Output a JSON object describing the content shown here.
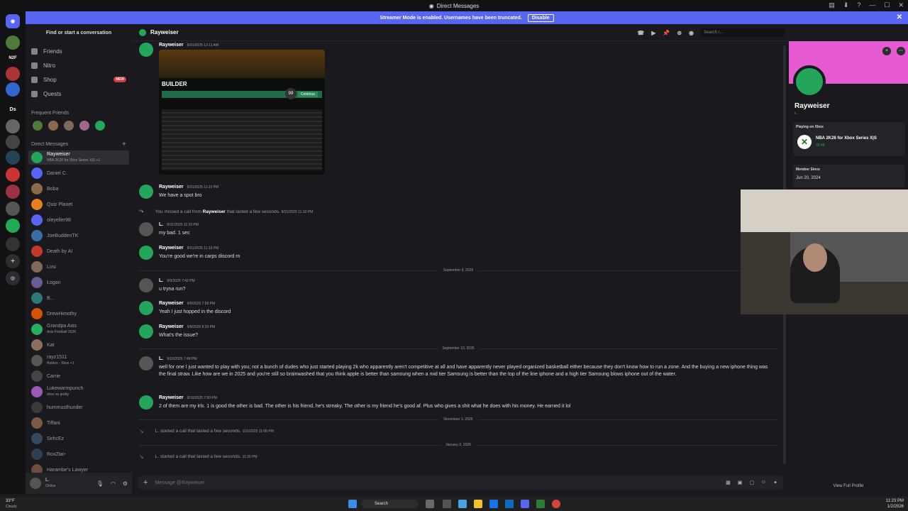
{
  "window": {
    "title": "Direct Messages"
  },
  "banner": {
    "text": "Streamer Mode is enabled. Usernames have been truncated.",
    "button": "Disable"
  },
  "servers": [
    "N2F",
    "Ds"
  ],
  "sidebar": {
    "find": "Find or start a conversation",
    "nav": [
      {
        "label": "Friends"
      },
      {
        "label": "Nitro"
      },
      {
        "label": "Shop",
        "badge": "NEW"
      },
      {
        "label": "Quests"
      }
    ],
    "frequent_label": "Frequent Friends",
    "dm_label": "Direct Messages",
    "dms": [
      {
        "name": "Rayweiser",
        "sub": "NBA 2K26 for Xbox Series X|S +1",
        "color": "#23a55a"
      },
      {
        "name": "Daniel C.",
        "sub": "",
        "color": "#5865f2"
      },
      {
        "name": "Boba",
        "sub": "",
        "color": "#8a6a4a"
      },
      {
        "name": "Quiz Planet",
        "sub": "",
        "color": "#e67e22"
      },
      {
        "name": "oleyeller98",
        "sub": "",
        "color": "#5865f2"
      },
      {
        "name": "JoeBuddenTK",
        "sub": "",
        "color": "#3a6ea5"
      },
      {
        "name": "Death by AI",
        "sub": "",
        "color": "#c0392b"
      },
      {
        "name": "Losi",
        "sub": "",
        "color": "#7f6a5a"
      },
      {
        "name": "Łogan",
        "sub": "",
        "color": "#6b5b95"
      },
      {
        "name": "B...",
        "sub": "",
        "color": "#2c7a7b"
      },
      {
        "name": "DrewHimothy",
        "sub": "",
        "color": "#d35400"
      },
      {
        "name": "Grandpa Axis",
        "sub": "Axis Football 2026",
        "color": "#27ae60"
      },
      {
        "name": "Kat",
        "sub": "",
        "color": "#8e6f5e"
      },
      {
        "name": "rayz1511",
        "sub": "Roblox - Xbox +1",
        "color": "#555"
      },
      {
        "name": "Carrie",
        "sub": "",
        "color": "#444"
      },
      {
        "name": "Lukewarmpunch",
        "sub": "shes so pretty",
        "color": "#9b59b6"
      },
      {
        "name": "hummusthunder",
        "sub": "",
        "color": "#3a3a3a"
      },
      {
        "name": "Tiffani",
        "sub": "",
        "color": "#7a5c4a"
      },
      {
        "name": "SirhcEz",
        "sub": "",
        "color": "#34495e"
      },
      {
        "name": "RoxZtar-",
        "sub": "",
        "color": "#2c3e50"
      },
      {
        "name": "Harambe's Lawyer",
        "sub": "",
        "color": "#6d4c41"
      }
    ],
    "user": {
      "name": "L.",
      "status": "Online"
    }
  },
  "header": {
    "name": "Rayweiser",
    "search": "Search r..."
  },
  "messages": [
    {
      "author": "Rayweiser",
      "time": "8/31/2025 12:11 AM",
      "text": "",
      "color": "#23a55a"
    },
    {
      "author": "Rayweiser",
      "time": "8/31/2025 11:10 PM",
      "text": "We have a spot bro",
      "color": "#23a55a"
    },
    {
      "author": "L.",
      "time": "8/31/2025 11:19 PM",
      "text": "my bad. 1 sec",
      "color": "#555"
    },
    {
      "author": "Rayweiser",
      "time": "8/31/2025 11:19 PM",
      "text": "You're good we're in carps discord rn",
      "color": "#23a55a"
    },
    {
      "author": "L.",
      "time": "9/9/2025 7:43 PM",
      "text": "u tryna run?",
      "color": "#555"
    },
    {
      "author": "Rayweiser",
      "time": "9/9/2025 7:58 PM",
      "text": "Yeah I just hopped in the discord",
      "color": "#23a55a"
    },
    {
      "author": "Rayweiser",
      "time": "9/9/2025 8:39 PM",
      "text": "What's the issue?",
      "color": "#23a55a"
    },
    {
      "author": "L.",
      "time": "9/10/2025 7:48 PM",
      "text": "well for one I just wanted to play with you; not a bunch of dudes who just started playing 2k who apparently aren't competitive at all and have apparently never played organized basketball either because they don't know how to run a zone. And the buying a new iphone thing was the final straw.  Like how are we in 2025 and you're still so brainwashed that you think apple is better than samsung when a mid tier Samsung is better than the top of the line iphone and a high tier Samsung blows iphone out of the water.",
      "color": "#555"
    },
    {
      "author": "Rayweiser",
      "time": "9/10/2025 7:50 PM",
      "text": "2 of them are my irls. 1 is good the other is bad. The other is his friend, he's streaky. The other is my friend he's good af. Plus who gives a shit what he does with his money. He earned it lol",
      "color": "#23a55a"
    }
  ],
  "system": {
    "missed": "You missed a call from",
    "missed_who": "Rayweiser",
    "missed_tail": "that lasted a few seconds.",
    "missed_time": "8/31/2025 11:10 PM",
    "call1": "L. started a call that lasted a few seconds.",
    "call1_time": "11/1/2025 11:08 PM",
    "call2": "L. started a call that lasted a few seconds.",
    "call2_time": "11:20 PM"
  },
  "dividers": [
    "September 9, 2025",
    "September 10, 2025",
    "November 1, 2025",
    "January 2, 2026"
  ],
  "attachment": {
    "title": "BUILDER",
    "rating": "99",
    "button": "Continue"
  },
  "composer": {
    "placeholder": "Message @Rayweiser"
  },
  "profile": {
    "name": "Rayweiser",
    "tag": "r...",
    "activity_label": "Playing on Xbox",
    "game": "NBA 2K26 for Xbox Series X|S",
    "elapsed": "35:48",
    "member_since_label": "Member Since",
    "member_since": "Jun 20, 2024",
    "view_full": "View Full Profile"
  },
  "taskbar": {
    "weather": "33°F",
    "weather_sub": "Cloudy",
    "search": "Search",
    "time": "11:23 PM",
    "date": "1/2/2026"
  }
}
